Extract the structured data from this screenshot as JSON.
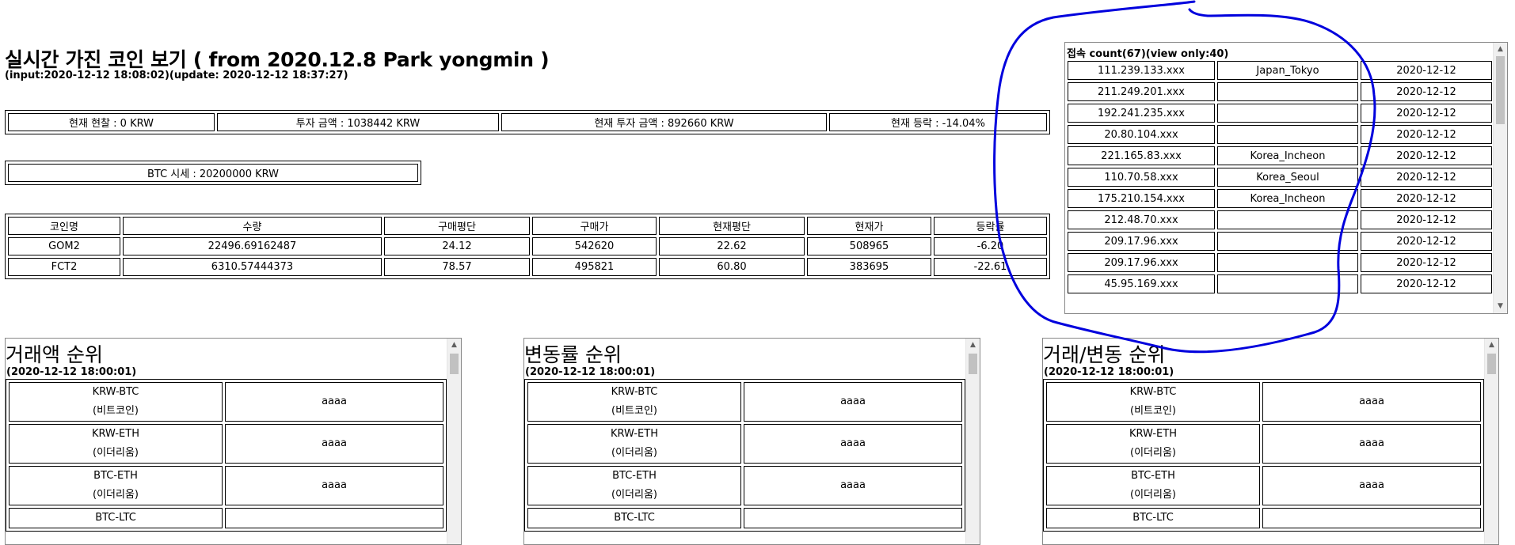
{
  "header": {
    "title": "실시간 가진 코인 보기 ( from 2020.12.8 Park yongmin )",
    "subtitle": "(input:2020-12-12 18:08:02)(update: 2020-12-12 18:37:27)"
  },
  "summary": {
    "cash": "현재 현찰 : 0 KRW",
    "invested": "투자 금액 : 1038442 KRW",
    "current_value": "현재 투자 금액 : 892660 KRW",
    "change": "현재 등락 : -14.04%"
  },
  "btc_price": "BTC 시세 : 20200000 KRW",
  "holdings": {
    "headers": [
      "코인명",
      "수량",
      "구매평단",
      "구매가",
      "현재평단",
      "현재가",
      "등락률"
    ],
    "rows": [
      [
        "GOM2",
        "22496.69162487",
        "24.12",
        "542620",
        "22.62",
        "508965",
        "-6.20"
      ],
      [
        "FCT2",
        "6310.57444373",
        "78.57",
        "495821",
        "60.80",
        "383695",
        "-22.61"
      ]
    ]
  },
  "connections": {
    "title": "접속 count(67)(view only:40)",
    "rows": [
      [
        "111.239.133.xxx",
        "Japan_Tokyo",
        "2020-12-12"
      ],
      [
        "211.249.201.xxx",
        "",
        "2020-12-12"
      ],
      [
        "192.241.235.xxx",
        "",
        "2020-12-12"
      ],
      [
        "20.80.104.xxx",
        "",
        "2020-12-12"
      ],
      [
        "221.165.83.xxx",
        "Korea_Incheon",
        "2020-12-12"
      ],
      [
        "110.70.58.xxx",
        "Korea_Seoul",
        "2020-12-12"
      ],
      [
        "175.210.154.xxx",
        "Korea_Incheon",
        "2020-12-12"
      ],
      [
        "212.48.70.xxx",
        "",
        "2020-12-12"
      ],
      [
        "209.17.96.xxx",
        "",
        "2020-12-12"
      ],
      [
        "209.17.96.xxx",
        "",
        "2020-12-12"
      ],
      [
        "45.95.169.xxx",
        "",
        "2020-12-12"
      ]
    ]
  },
  "rankings": {
    "volume": {
      "title": "거래액 순위",
      "time": "(2020-12-12 18:00:01)",
      "items": [
        {
          "market": "KRW-BTC",
          "name": "(비트코인)",
          "value": "aaaa"
        },
        {
          "market": "KRW-ETH",
          "name": "(이더리움)",
          "value": "aaaa"
        },
        {
          "market": "BTC-ETH",
          "name": "(이더리움)",
          "value": "aaaa"
        },
        {
          "market": "BTC-LTC",
          "name": "",
          "value": ""
        }
      ]
    },
    "change": {
      "title": "변동률 순위",
      "time": "(2020-12-12 18:00:01)",
      "items": [
        {
          "market": "KRW-BTC",
          "name": "(비트코인)",
          "value": "aaaa"
        },
        {
          "market": "KRW-ETH",
          "name": "(이더리움)",
          "value": "aaaa"
        },
        {
          "market": "BTC-ETH",
          "name": "(이더리움)",
          "value": "aaaa"
        },
        {
          "market": "BTC-LTC",
          "name": "",
          "value": ""
        }
      ]
    },
    "combined": {
      "title": "거래/변동 순위",
      "time": "(2020-12-12 18:00:01)",
      "items": [
        {
          "market": "KRW-BTC",
          "name": "(비트코인)",
          "value": "aaaa"
        },
        {
          "market": "KRW-ETH",
          "name": "(이더리움)",
          "value": "aaaa"
        },
        {
          "market": "BTC-ETH",
          "name": "(이더리움)",
          "value": "aaaa"
        },
        {
          "market": "BTC-LTC",
          "name": "",
          "value": ""
        }
      ]
    }
  },
  "icons": {
    "scroll_up": "▲",
    "scroll_down": "▼"
  },
  "colors": {
    "annotation": "#0000dd"
  }
}
